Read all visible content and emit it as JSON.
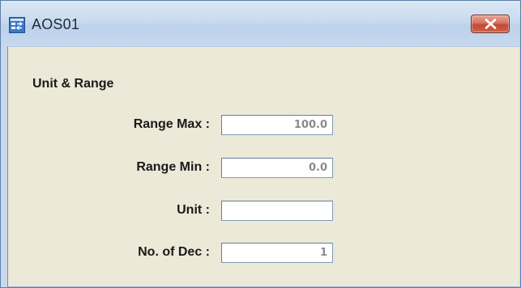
{
  "window": {
    "title": "AOS01"
  },
  "section": {
    "title": "Unit & Range"
  },
  "fields": [
    {
      "label": "Range Max :",
      "value": "100.0"
    },
    {
      "label": "Range Min :",
      "value": "0.0"
    },
    {
      "label": "Unit :",
      "value": ""
    },
    {
      "label": "No. of Dec :",
      "value": "1"
    }
  ],
  "colors": {
    "titlebar": "#c9dbef",
    "client_background": "#ece9d8",
    "close_button": "#c24a34",
    "input_value_text": "#8a8a8a"
  },
  "icons": {
    "app": "app-window-icon",
    "close": "close-icon"
  }
}
